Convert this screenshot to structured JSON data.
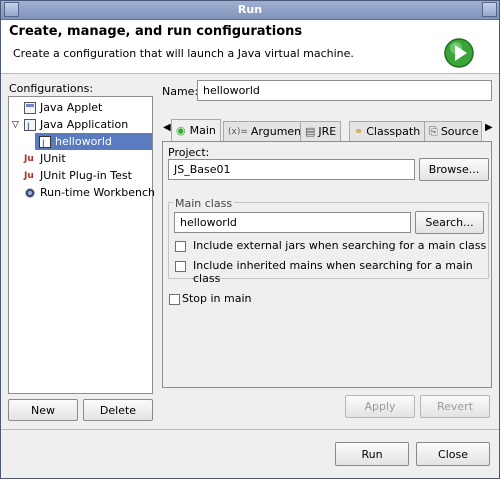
{
  "window": {
    "title": "Run"
  },
  "header": {
    "title": "Create, manage, and run configurations",
    "subtitle": "Create a configuration that will launch a Java virtual machine."
  },
  "sidebar": {
    "label": "Configurations:",
    "items": [
      {
        "label": "Java Applet",
        "icon": "java-applet-icon"
      },
      {
        "label": "Java Application",
        "icon": "java-application-icon",
        "expanded": true
      },
      {
        "label": "helloworld",
        "icon": "java-config-icon",
        "selected": true
      },
      {
        "label": "JUnit",
        "icon": "junit-icon"
      },
      {
        "label": "JUnit Plug-in Test",
        "icon": "junit-plugin-icon"
      },
      {
        "label": "Run-time Workbench",
        "icon": "workbench-icon"
      }
    ],
    "new_label": "New",
    "delete_label": "Delete"
  },
  "form": {
    "name_label": "Name:",
    "name_value": "helloworld",
    "tabs": [
      {
        "label": "Main",
        "active": true
      },
      {
        "label": "Arguments"
      },
      {
        "label": "JRE"
      },
      {
        "label": "Classpath"
      },
      {
        "label": "Source"
      }
    ],
    "project_label": "Project:",
    "project_value": "JS_Base01",
    "browse_label": "Browse...",
    "main_class_label": "Main class",
    "main_class_value": "helloworld",
    "search_label": "Search...",
    "include_external": "Include external jars when searching for a main class",
    "include_inherited": "Include inherited mains when searching for a main class",
    "stop_in_main": "Stop in main",
    "apply_label": "Apply",
    "revert_label": "Revert"
  },
  "footer": {
    "run_label": "Run",
    "close_label": "Close"
  },
  "colors": {
    "selection": "#5a7bbf",
    "titlebar": "#8ea2c8",
    "run_green": "#3aa63a"
  }
}
